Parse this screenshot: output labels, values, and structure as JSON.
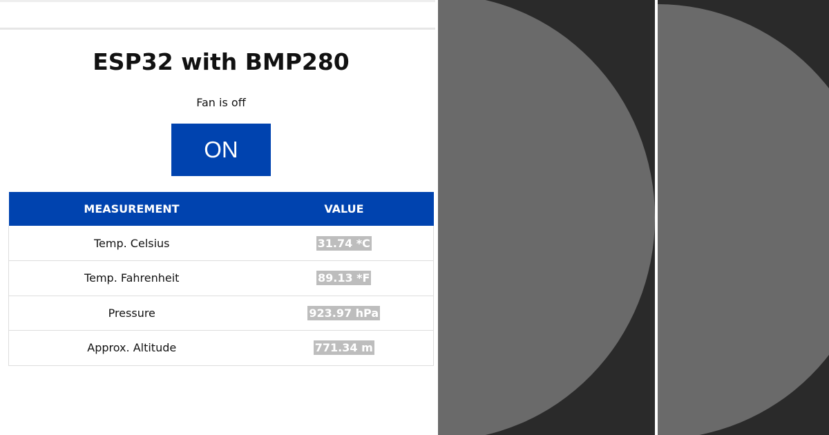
{
  "page": {
    "title": "ESP32 with BMP280",
    "fan_status": "Fan is off",
    "toggle_button_label": "ON"
  },
  "table": {
    "headers": [
      "MEASUREMENT",
      "VALUE"
    ],
    "rows": [
      {
        "measurement": "Temp. Celsius",
        "value": "31.74 *C"
      },
      {
        "measurement": "Temp. Fahrenheit",
        "value": "89.13 *F"
      },
      {
        "measurement": "Pressure",
        "value": "923.97 hPa"
      },
      {
        "measurement": "Approx. Altitude",
        "value": "771.34 m"
      }
    ]
  },
  "colors": {
    "accent": "#0043af",
    "value_chip": "#bdbdbd",
    "panel_dark": "#2a2a2a",
    "circle_gray": "#6a6a6a"
  }
}
